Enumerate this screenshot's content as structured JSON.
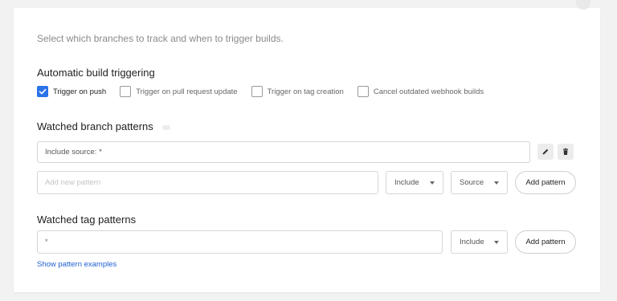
{
  "description": "Select which branches to track and when to trigger builds.",
  "auto_build": {
    "title": "Automatic build triggering",
    "options": [
      {
        "label": "Trigger on push",
        "checked": true
      },
      {
        "label": "Trigger on pull request update",
        "checked": false
      },
      {
        "label": "Trigger on tag creation",
        "checked": false
      },
      {
        "label": "Cancel outdated webhook builds",
        "checked": false
      }
    ]
  },
  "branch_patterns": {
    "title": "Watched branch patterns",
    "existing": "Include source: *",
    "edit_icon": "pencil-icon",
    "delete_icon": "trash-icon",
    "new_placeholder": "Add new pattern",
    "type_select": "Include",
    "source_select": "Source",
    "add_label": "Add pattern"
  },
  "tag_patterns": {
    "title": "Watched tag patterns",
    "value": "*",
    "type_select": "Include",
    "add_label": "Add pattern",
    "examples_link": "Show pattern examples"
  },
  "colors": {
    "accent": "#2a73e8",
    "link": "#1f5fd1"
  }
}
